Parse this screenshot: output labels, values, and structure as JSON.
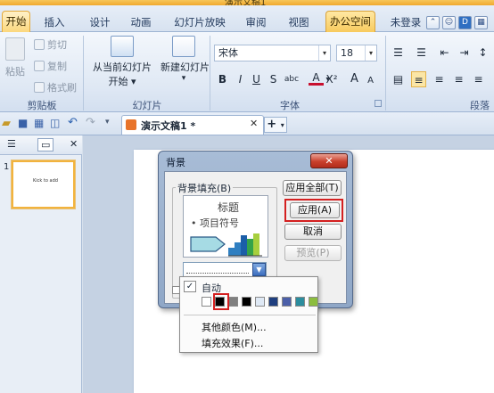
{
  "window": {
    "title": "演示文稿1"
  },
  "tabs": {
    "file": "开始",
    "insert": "插入",
    "design": "设计",
    "animation": "动画",
    "slideshow": "幻灯片放映",
    "review": "审阅",
    "view": "视图",
    "office": "办公空间",
    "login": "未登录"
  },
  "ribbon": {
    "paste": "粘贴",
    "cut": "剪切",
    "copy": "复制",
    "format_painter": "格式刷",
    "clipboard_group": "剪贴板",
    "from_current": "从当前幻灯片",
    "start": "开始",
    "new_slide": "新建幻灯片",
    "slides_group": "幻灯片",
    "font_name": "宋体",
    "font_size": "18",
    "bold": "B",
    "italic": "I",
    "underline": "U",
    "strike": "S",
    "shadow": "abc",
    "font_color": "A",
    "superscript": "X²",
    "grow": "A",
    "shrink": "A",
    "font_group": "字体",
    "paragraph_group": "段落"
  },
  "doc_tab": {
    "label": "演示文稿1 *"
  },
  "slide_pane": {
    "thumb_number": "1",
    "thumb_text": "Kick to add"
  },
  "dialog": {
    "title": "背景",
    "fill_label": "背景填充(B)",
    "preview_title": "标题",
    "preview_bullet": "• 项目符号",
    "apply_all": "应用全部(T)",
    "apply": "应用(A)",
    "cancel": "取消",
    "preview": "预览(P)"
  },
  "color_menu": {
    "auto": "自动",
    "more_colors": "其他颜色(M)...",
    "fill_effects": "填充效果(F)...",
    "swatches": [
      "#ffffff",
      "#000000",
      "#808080",
      "#000000",
      "#dfe9f5",
      "#1f3f7f",
      "#4b5fa8",
      "#2c8d9e",
      "#8cbd3f"
    ]
  },
  "colors": {
    "accent": "#f2b33d",
    "highlight_red": "#d42020",
    "dialog_frame": "#8fa7c7"
  }
}
